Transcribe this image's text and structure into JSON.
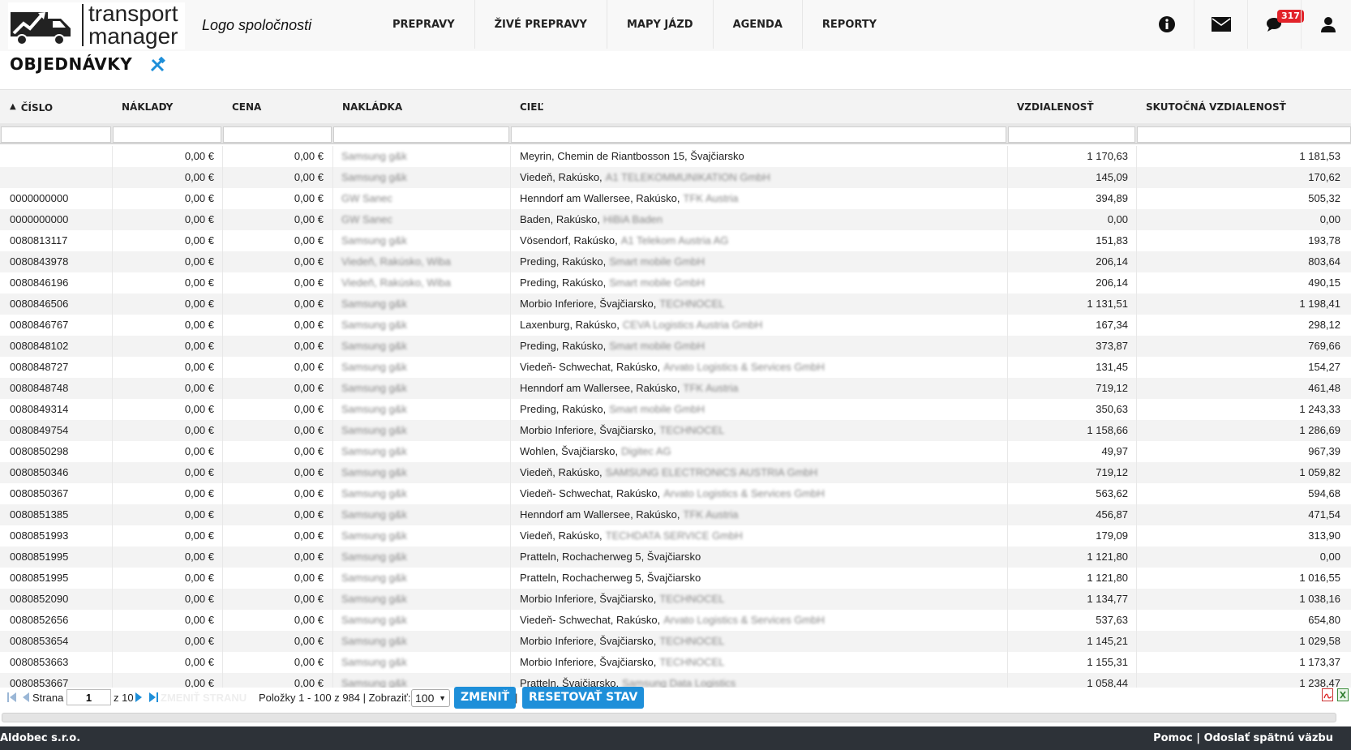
{
  "header": {
    "logo_line1": "transport",
    "logo_line2": "manager",
    "company": "Logo spoločnosti",
    "nav": [
      "PREPRAVY",
      "ŽIVÉ PREPRAVY",
      "MAPY JÁZD",
      "AGENDA",
      "REPORTY"
    ],
    "notification_count": "317"
  },
  "page": {
    "title": "OBJEDNÁVKY"
  },
  "columns": [
    "ČÍSLO",
    "NÁKLADY",
    "CENA",
    "NAKLÁDKA",
    "CIEĽ",
    "VZDIALENOSŤ",
    "SKUTOČNÁ VZDIALENOSŤ"
  ],
  "rows": [
    {
      "cislo": "",
      "naklady": "0,00 €",
      "cena": "0,00 €",
      "nakladka": "Samsung g&k",
      "ciel": "Meyrin, Chemin de Riantbosson 15, Švajčiarsko",
      "ciel_extra": "",
      "vzd": "1 170,63",
      "skut": "1 181,53"
    },
    {
      "cislo": "",
      "naklady": "0,00 €",
      "cena": "0,00 €",
      "nakladka": "Samsung g&k",
      "ciel": "Viedeň, Rakúsko,",
      "ciel_extra": "A1 TELEKOMMUNIKATION GmbH",
      "vzd": "145,09",
      "skut": "170,62"
    },
    {
      "cislo": "0000000000",
      "naklady": "0,00 €",
      "cena": "0,00 €",
      "nakladka": "GW Sanec",
      "ciel": "Henndorf am Wallersee, Rakúsko,",
      "ciel_extra": "TFK Austria",
      "vzd": "394,89",
      "skut": "505,32"
    },
    {
      "cislo": "0000000000",
      "naklady": "0,00 €",
      "cena": "0,00 €",
      "nakladka": "GW Sanec",
      "ciel": "Baden, Rakúsko,",
      "ciel_extra": "HiBiA Baden",
      "vzd": "0,00",
      "skut": "0,00"
    },
    {
      "cislo": "0080813117",
      "naklady": "0,00 €",
      "cena": "0,00 €",
      "nakladka": "Samsung g&k",
      "ciel": "Vösendorf, Rakúsko,",
      "ciel_extra": "A1 Telekom Austria AG",
      "vzd": "151,83",
      "skut": "193,78"
    },
    {
      "cislo": "0080843978",
      "naklady": "0,00 €",
      "cena": "0,00 €",
      "nakladka": "Viedeň, Rakúsko, Wiba",
      "ciel": "Preding, Rakúsko,",
      "ciel_extra": "Smart mobile GmbH",
      "vzd": "206,14",
      "skut": "803,64"
    },
    {
      "cislo": "0080846196",
      "naklady": "0,00 €",
      "cena": "0,00 €",
      "nakladka": "Viedeň, Rakúsko, Wiba",
      "ciel": "Preding, Rakúsko,",
      "ciel_extra": "Smart mobile GmbH",
      "vzd": "206,14",
      "skut": "490,15"
    },
    {
      "cislo": "0080846506",
      "naklady": "0,00 €",
      "cena": "0,00 €",
      "nakladka": "Samsung g&k",
      "ciel": "Morbio Inferiore, Švajčiarsko,",
      "ciel_extra": "TECHNOCEL",
      "vzd": "1 131,51",
      "skut": "1 198,41"
    },
    {
      "cislo": "0080846767",
      "naklady": "0,00 €",
      "cena": "0,00 €",
      "nakladka": "Samsung g&k",
      "ciel": "Laxenburg, Rakúsko,",
      "ciel_extra": "CEVA Logistics Austria GmbH",
      "vzd": "167,34",
      "skut": "298,12"
    },
    {
      "cislo": "0080848102",
      "naklady": "0,00 €",
      "cena": "0,00 €",
      "nakladka": "Samsung g&k",
      "ciel": "Preding, Rakúsko,",
      "ciel_extra": "Smart mobile GmbH",
      "vzd": "373,87",
      "skut": "769,66"
    },
    {
      "cislo": "0080848727",
      "naklady": "0,00 €",
      "cena": "0,00 €",
      "nakladka": "Samsung g&k",
      "ciel": "Viedeň- Schwechat, Rakúsko,",
      "ciel_extra": "Arvato Logistics & Services GmbH",
      "vzd": "131,45",
      "skut": "154,27"
    },
    {
      "cislo": "0080848748",
      "naklady": "0,00 €",
      "cena": "0,00 €",
      "nakladka": "Samsung g&k",
      "ciel": "Henndorf am Wallersee, Rakúsko,",
      "ciel_extra": "TFK Austria",
      "vzd": "719,12",
      "skut": "461,48"
    },
    {
      "cislo": "0080849314",
      "naklady": "0,00 €",
      "cena": "0,00 €",
      "nakladka": "Samsung g&k",
      "ciel": "Preding, Rakúsko,",
      "ciel_extra": "Smart mobile GmbH",
      "vzd": "350,63",
      "skut": "1 243,33"
    },
    {
      "cislo": "0080849754",
      "naklady": "0,00 €",
      "cena": "0,00 €",
      "nakladka": "Samsung g&k",
      "ciel": "Morbio Inferiore, Švajčiarsko,",
      "ciel_extra": "TECHNOCEL",
      "vzd": "1 158,66",
      "skut": "1 286,69"
    },
    {
      "cislo": "0080850298",
      "naklady": "0,00 €",
      "cena": "0,00 €",
      "nakladka": "Samsung g&k",
      "ciel": "Wohlen, Švajčiarsko,",
      "ciel_extra": "Digitec AG",
      "vzd": "49,97",
      "skut": "967,39"
    },
    {
      "cislo": "0080850346",
      "naklady": "0,00 €",
      "cena": "0,00 €",
      "nakladka": "Samsung g&k",
      "ciel": "Viedeň, Rakúsko,",
      "ciel_extra": "SAMSUNG ELECTRONICS AUSTRIA GmbH",
      "vzd": "719,12",
      "skut": "1 059,82"
    },
    {
      "cislo": "0080850367",
      "naklady": "0,00 €",
      "cena": "0,00 €",
      "nakladka": "Samsung g&k",
      "ciel": "Viedeň- Schwechat, Rakúsko,",
      "ciel_extra": "Arvato Logistics & Services GmbH",
      "vzd": "563,62",
      "skut": "594,68"
    },
    {
      "cislo": "0080851385",
      "naklady": "0,00 €",
      "cena": "0,00 €",
      "nakladka": "Samsung g&k",
      "ciel": "Henndorf am Wallersee, Rakúsko,",
      "ciel_extra": "TFK Austria",
      "vzd": "456,87",
      "skut": "471,54"
    },
    {
      "cislo": "0080851993",
      "naklady": "0,00 €",
      "cena": "0,00 €",
      "nakladka": "Samsung g&k",
      "ciel": "Viedeň, Rakúsko,",
      "ciel_extra": "TECHDATA SERVICE GmbH",
      "vzd": "179,09",
      "skut": "313,90"
    },
    {
      "cislo": "0080851995",
      "naklady": "0,00 €",
      "cena": "0,00 €",
      "nakladka": "Samsung g&k",
      "ciel": "Pratteln, Rochacherweg 5, Švajčiarsko",
      "ciel_extra": "",
      "vzd": "1 121,80",
      "skut": "0,00"
    },
    {
      "cislo": "0080851995",
      "naklady": "0,00 €",
      "cena": "0,00 €",
      "nakladka": "Samsung g&k",
      "ciel": "Pratteln, Rochacherweg 5, Švajčiarsko",
      "ciel_extra": "",
      "vzd": "1 121,80",
      "skut": "1 016,55"
    },
    {
      "cislo": "0080852090",
      "naklady": "0,00 €",
      "cena": "0,00 €",
      "nakladka": "Samsung g&k",
      "ciel": "Morbio Inferiore, Švajčiarsko,",
      "ciel_extra": "TECHNOCEL",
      "vzd": "1 134,77",
      "skut": "1 038,16"
    },
    {
      "cislo": "0080852656",
      "naklady": "0,00 €",
      "cena": "0,00 €",
      "nakladka": "Samsung g&k",
      "ciel": "Viedeň- Schwechat, Rakúsko,",
      "ciel_extra": "Arvato Logistics & Services GmbH",
      "vzd": "537,63",
      "skut": "654,80"
    },
    {
      "cislo": "0080853654",
      "naklady": "0,00 €",
      "cena": "0,00 €",
      "nakladka": "Samsung g&k",
      "ciel": "Morbio Inferiore, Švajčiarsko,",
      "ciel_extra": "TECHNOCEL",
      "vzd": "1 145,21",
      "skut": "1 029,58"
    },
    {
      "cislo": "0080853663",
      "naklady": "0,00 €",
      "cena": "0,00 €",
      "nakladka": "Samsung g&k",
      "ciel": "Morbio Inferiore, Švajčiarsko,",
      "ciel_extra": "TECHNOCEL",
      "vzd": "1 155,31",
      "skut": "1 173,37"
    },
    {
      "cislo": "0080853667",
      "naklady": "0,00 €",
      "cena": "0,00 €",
      "nakladka": "Samsung g&k",
      "ciel": "Pratteln, Švajčiarsko,",
      "ciel_extra": "Samsung Data Logistics",
      "vzd": "1 058,44",
      "skut": "1 238,47"
    }
  ],
  "pager": {
    "page_label": "Strana",
    "page_value": "1",
    "of_pages": "z 10",
    "ghost_label": "ZMENIŤ STRANU",
    "items_text": "Položky 1 - 100 z 984 | Zobraziť:",
    "page_size": "100",
    "change_button": "ZMENIŤ",
    "separator": "|",
    "reset_button": "RESETOVAŤ STAV"
  },
  "footer": {
    "company": "Aldobec s.r.o.",
    "help": "Pomoc",
    "separator": "|",
    "feedback": "Odoslať spätnú väzbu"
  }
}
